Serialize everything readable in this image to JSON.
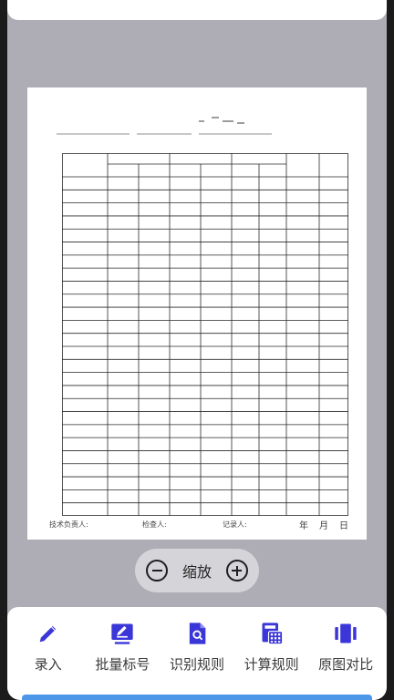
{
  "signatures": {
    "tech_lead": "技术负责人:",
    "inspector": "检查人:",
    "recorder": "记录人:",
    "year": "年",
    "month": "月",
    "day": "日"
  },
  "zoom": {
    "label": "缩放"
  },
  "toolbar": {
    "items": [
      {
        "label": "录入",
        "icon": "pencil-icon"
      },
      {
        "label": "批量标号",
        "icon": "edit-box-icon"
      },
      {
        "label": "识别规则",
        "icon": "document-search-icon"
      },
      {
        "label": "计算规则",
        "icon": "calculator-icon"
      },
      {
        "label": "原图对比",
        "icon": "compare-icon"
      }
    ]
  },
  "colors": {
    "accent": "#3b36d8",
    "viewer_bg": "#aeadb6",
    "bottom_bar": "#4d97e8"
  }
}
